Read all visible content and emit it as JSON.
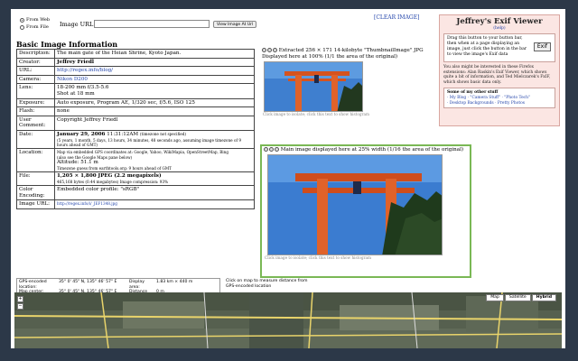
{
  "topbar": {
    "radio_web": "From Web",
    "radio_file": "From File",
    "url_label": "Image URL:",
    "url_value": "",
    "view_button": "View Image At Url",
    "clear_link": "[CLEAR IMAGE]"
  },
  "viewer": {
    "title": "Jeffrey's Exif Viewer",
    "help": "(help)",
    "drag_text": "Drag this button to your button bar, then when at a page displaying an image, just click the button in the bar to view the image's Exif data",
    "exif_button": "Exif",
    "note": "You also might be interested in these Firefox extensions: Alan Raskin's Exif Viewer, which shows quite a bit of information, and Ted Mielczarek's FxIF, which shows basic data only.",
    "other_title": "Some of my other stuff",
    "other_links_1": "· My Blog · \"Camera Stuff\" · \"Photo Tech\"",
    "other_links_2": "· Desktop Backgrounds · Pretty Photos"
  },
  "section_title": "Basic Image Information",
  "info": {
    "description_key": "Description:",
    "description": "The main gate of the Heian Shrine, Kyoto Japan.",
    "creator_key": "Creator:",
    "creator": "Jeffrey Friedl",
    "url_key": "URL:",
    "url": "http://regex.info/blog/",
    "camera_key": "Camera:",
    "camera": "Nikon D200",
    "lens_key": "Lens:",
    "lens_1": "18-200 mm f/3.5-5.6",
    "lens_2": "Shot at 18 mm",
    "exposure_key": "Exposure:",
    "exposure": "Auto exposure, Program AE, 1/320 sec, f/5.6, ISO 125",
    "flash_key": "Flash:",
    "flash": "none",
    "comment_key": "User Comment:",
    "comment": "Copyright Jeffrey Friedl",
    "date_key": "Date:",
    "date_main": "January 29, 2006",
    "date_time": "11:31:12AM",
    "date_tz": "(timezone not specified)",
    "date_ago": "(5 years, 1 month, 5 days, 13 hours, 34 minutes, 48 seconds ago, assuming image timezone of 9 hours ahead of GMT)",
    "location_key": "Location:",
    "location_1": "Map via embedded GPS coordinates at: Google, Yahoo, WikiMapia, OpenStreetMap, Bing",
    "location_2": "(also see the Google Maps pane below)",
    "altitude": "Altitude: 51.1 m",
    "tz_note": "Timezone guess from earthtools.org: 9 hours ahead of GMT",
    "file_key": "File:",
    "file_main": "1,205 × 1,800 JPEG (2.2 megapixels)",
    "file_sub": "465,168 bytes (0.44 megabytes)    Image compression: 93%",
    "color_key": "Color Encoding:",
    "color": "Embedded color profile: \"sRGB\"",
    "image_url_key": "Image URL:",
    "image_url": "http://regex.info/i/_JEF1348.jpg"
  },
  "panel1": {
    "head": "Extracted 256 × 171 14-kilobyte \"ThumbnailImage\" JPG",
    "head2": "Displayed here at 100% (1/1 the area of the original)",
    "caption": "Click image to isolate; click this text to show histogram"
  },
  "panel2": {
    "head": "Main image displayed here at 25% width (1/16 the area of the original)",
    "caption": "Click image to isolate; click this text to show histogram"
  },
  "mapbar": {
    "gps_key": "GPS-encoded location:",
    "gps_val": "35° 0' 45\" N, 135° 46' 57\" E",
    "center_key": "Map center:",
    "center_val": "35° 0' 45\" N, 135° 46' 57\" E",
    "area_key": "Display area:",
    "area_val": "1.83 km × 440 m",
    "dist_key": "Distance between:",
    "dist_val": "0 m",
    "click_note": "Click on map to measure distance from GPS-encoded location"
  },
  "map": {
    "types": [
      "Map",
      "Satellite",
      "Hybrid"
    ],
    "selected": "Hybrid"
  }
}
